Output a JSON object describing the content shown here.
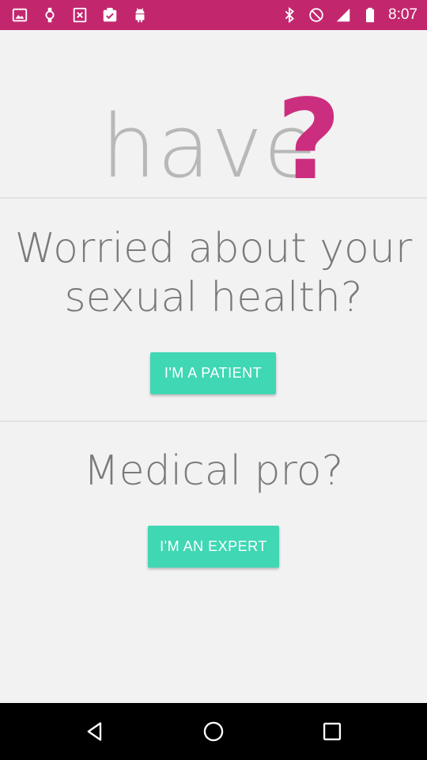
{
  "status_bar": {
    "time": "8:07",
    "left_icons": [
      "image-icon",
      "watch-icon",
      "close-box-icon",
      "checklist-icon",
      "android-icon"
    ],
    "right_icons": [
      "bluetooth-icon",
      "do-not-disturb-icon",
      "signal-icon",
      "battery-icon"
    ]
  },
  "logo": {
    "word": "have",
    "mark": "?"
  },
  "patient_section": {
    "title_line1": "Worried about your",
    "title_line2": "sexual health?",
    "button_label": "I'M A PATIENT"
  },
  "expert_section": {
    "title": "Medical pro?",
    "button_label": "I'M AN EXPERT"
  },
  "nav_bar": {
    "buttons": [
      "back-icon",
      "home-icon",
      "recents-icon"
    ]
  },
  "colors": {
    "status_bar": "#c2276e",
    "accent_pink": "#cc2e7f",
    "button": "#40d7b4",
    "background": "#f2f2f2",
    "text_gray": "#7a7a7a"
  }
}
